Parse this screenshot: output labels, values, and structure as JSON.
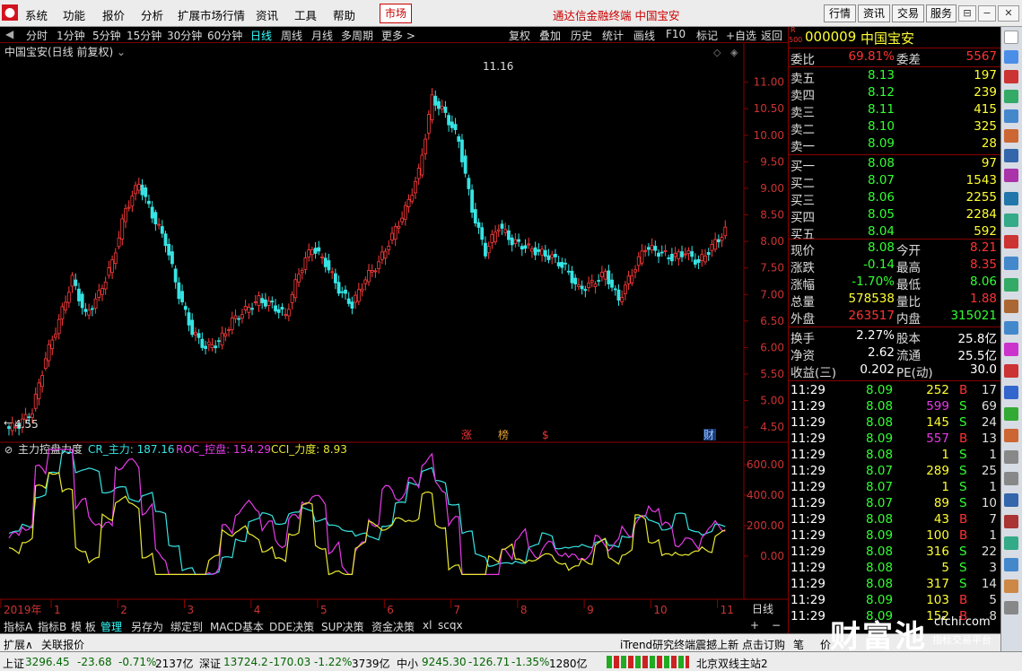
{
  "menu": [
    "系统",
    "功能",
    "报价",
    "分析",
    "扩展市场行情",
    "资讯",
    "工具",
    "帮助"
  ],
  "market_btn": "市场",
  "app_title": "通达信金融终端  中国宝安",
  "top_right_btns": [
    "行情",
    "资讯",
    "交易",
    "服务"
  ],
  "periods": [
    "分时",
    "1分钟",
    "5分钟",
    "15分钟",
    "30分钟",
    "60分钟",
    "日线",
    "周线",
    "月线",
    "多周期",
    "更多 >"
  ],
  "active_period": "日线",
  "tools": [
    "复权",
    "叠加",
    "历史",
    "统计",
    "画线",
    "F10",
    "标记",
    "+自选",
    "返回"
  ],
  "stock_title": "中国宝安(日线 前复权)",
  "price_axis": [
    "11.00",
    "10.50",
    "10.00",
    "9.50",
    "9.00",
    "8.50",
    "8.00",
    "7.50",
    "7.00",
    "6.50",
    "6.00",
    "5.50",
    "5.00",
    "4.50"
  ],
  "price_high_label": "11.16",
  "price_low_label": "4.55",
  "event_markers": [
    "涨",
    "榜",
    "$",
    "财"
  ],
  "indicator": {
    "name": "主力控盘力度",
    "cr_label": "CR_主力: 187.16",
    "roc_label": "ROC_控盘: 154.29",
    "cci_label": "CCI_力度: 8.93"
  },
  "ind_axis": [
    "600.00",
    "400.00",
    "200.00",
    "0.00"
  ],
  "date_axis": [
    "2019年",
    "1",
    "2",
    "3",
    "4",
    "5",
    "6",
    "7",
    "8",
    "9",
    "10",
    "11"
  ],
  "date_period": "日线",
  "chart_data": {
    "type": "candlestick",
    "title": "中国宝安(日线 前复权)",
    "ylim": [
      4.3,
      11.4
    ],
    "x": [
      "2019-01",
      "2019-02",
      "2019-03",
      "2019-04",
      "2019-05",
      "2019-06",
      "2019-07",
      "2019-08",
      "2019-09",
      "2019-10",
      "2019-11"
    ],
    "close": [
      [
        4.55,
        4.8,
        5.8,
        6.5,
        7.3
      ],
      [
        6.6,
        7.0,
        7.6,
        8.6,
        9.1
      ],
      [
        8.5,
        8.0,
        7.0,
        6.3,
        6.0
      ],
      [
        6.1,
        6.5,
        6.7,
        6.9,
        6.8
      ],
      [
        6.6,
        7.4,
        7.9,
        7.6,
        7.1
      ],
      [
        6.8,
        7.3,
        7.6,
        8.1,
        8.6
      ],
      [
        9.3,
        10.7,
        10.4,
        9.9,
        8.6
      ],
      [
        7.8,
        8.3,
        8.0,
        7.9,
        7.8
      ],
      [
        7.7,
        7.5,
        7.1,
        7.2,
        7.4
      ],
      [
        6.9,
        7.4,
        7.9,
        7.8,
        7.7
      ],
      [
        7.8,
        7.6,
        7.9,
        8.2
      ]
    ],
    "series": [
      {
        "name": "CR_主力",
        "color": "#36e4e4",
        "last": 187.16
      },
      {
        "name": "ROC_控盘",
        "color": "#e83ae8",
        "last": 154.29
      },
      {
        "name": "CCI_力度",
        "color": "#e8e830",
        "last": 8.93
      }
    ]
  },
  "quote": {
    "code": "000009",
    "name": "中国宝安",
    "badge_top": "R",
    "badge_bot": "500",
    "weibi_label": "委比",
    "weibi": "69.81%",
    "weicha_label": "委差",
    "weicha": "5567",
    "asks": [
      {
        "l": "卖五",
        "p": "8.13",
        "v": "197"
      },
      {
        "l": "卖四",
        "p": "8.12",
        "v": "239"
      },
      {
        "l": "卖三",
        "p": "8.11",
        "v": "415"
      },
      {
        "l": "卖二",
        "p": "8.10",
        "v": "325"
      },
      {
        "l": "卖一",
        "p": "8.09",
        "v": "28"
      }
    ],
    "bids": [
      {
        "l": "买一",
        "p": "8.08",
        "v": "97"
      },
      {
        "l": "买二",
        "p": "8.07",
        "v": "1543"
      },
      {
        "l": "买三",
        "p": "8.06",
        "v": "2255"
      },
      {
        "l": "买四",
        "p": "8.05",
        "v": "2284"
      },
      {
        "l": "买五",
        "p": "8.04",
        "v": "592"
      }
    ],
    "stats": [
      {
        "l1": "现价",
        "v1": "8.08",
        "l2": "今开",
        "v2": "8.21"
      },
      {
        "l1": "涨跌",
        "v1": "-0.14",
        "l2": "最高",
        "v2": "8.35"
      },
      {
        "l1": "涨幅",
        "v1": "-1.70%",
        "l2": "最低",
        "v2": "8.06"
      },
      {
        "l1": "总量",
        "v1": "578538",
        "l2": "量比",
        "v2": "1.88"
      },
      {
        "l1": "外盘",
        "v1": "263517",
        "l2": "内盘",
        "v2": "315021"
      }
    ],
    "fin": [
      {
        "l1": "换手",
        "v1": "2.27%",
        "l2": "股本",
        "v2": "25.8亿"
      },
      {
        "l1": "净资",
        "v1": "2.62",
        "l2": "流通",
        "v2": "25.5亿"
      },
      {
        "l1": "收益(三)",
        "v1": "0.202",
        "l2": "PE(动)",
        "v2": "30.0"
      }
    ],
    "ticks": [
      {
        "t": "11:29",
        "p": "8.09",
        "v": "252",
        "d": "B",
        "n": "17"
      },
      {
        "t": "11:29",
        "p": "8.08",
        "v": "599",
        "d": "S",
        "n": "69"
      },
      {
        "t": "11:29",
        "p": "8.08",
        "v": "145",
        "d": "S",
        "n": "24"
      },
      {
        "t": "11:29",
        "p": "8.09",
        "v": "557",
        "d": "B",
        "n": "13"
      },
      {
        "t": "11:29",
        "p": "8.08",
        "v": "1",
        "d": "S",
        "n": "1"
      },
      {
        "t": "11:29",
        "p": "8.07",
        "v": "289",
        "d": "S",
        "n": "25"
      },
      {
        "t": "11:29",
        "p": "8.07",
        "v": "1",
        "d": "S",
        "n": "1"
      },
      {
        "t": "11:29",
        "p": "8.07",
        "v": "89",
        "d": "S",
        "n": "10"
      },
      {
        "t": "11:29",
        "p": "8.08",
        "v": "43",
        "d": "B",
        "n": "7"
      },
      {
        "t": "11:29",
        "p": "8.09",
        "v": "100",
        "d": "B",
        "n": "1"
      },
      {
        "t": "11:29",
        "p": "8.08",
        "v": "316",
        "d": "S",
        "n": "22"
      },
      {
        "t": "11:29",
        "p": "8.08",
        "v": "5",
        "d": "S",
        "n": "3"
      },
      {
        "t": "11:29",
        "p": "8.08",
        "v": "317",
        "d": "S",
        "n": "14"
      },
      {
        "t": "11:29",
        "p": "8.09",
        "v": "103",
        "d": "B",
        "n": "5"
      },
      {
        "t": "11:29",
        "p": "8.09",
        "v": "152",
        "d": "B",
        "n": "8"
      }
    ]
  },
  "tabs": [
    "指标A",
    "指标B",
    "模 板",
    "管理",
    "另存为",
    "绑定到",
    "MACD基本",
    "DDE决策",
    "SUP决策",
    "资金决策",
    "xl",
    "scqx"
  ],
  "bottom_left": [
    "扩展∧",
    "关联报价"
  ],
  "ticker": "iTrend研究终端震撼上新 点击订购",
  "right_tabs": [
    "笔",
    "价"
  ],
  "status": {
    "sh": {
      "name": "上证",
      "val": "3296.45",
      "chg": "-23.68",
      "pct": "-0.71%",
      "amt": "2137亿"
    },
    "sz": {
      "name": "深证",
      "val": "13724.2",
      "chg": "-170.03",
      "pct": "-1.22%",
      "amt": "3739亿"
    },
    "zx": {
      "name": "中小",
      "val": "9245.30",
      "chg": "-126.71",
      "pct": "-1.35%",
      "amt": "1280亿"
    },
    "server": "北京双线主站2"
  },
  "watermark": {
    "brand": "财富池",
    "site": "cfchi.com",
    "slogan": "指标交易平台"
  }
}
